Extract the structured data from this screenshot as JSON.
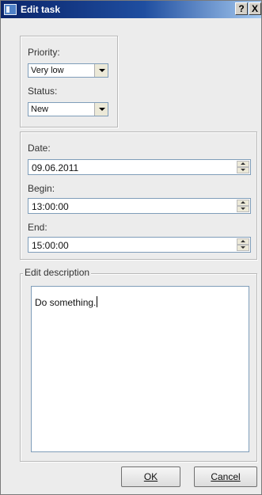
{
  "window": {
    "title": "Edit task",
    "help_label": "?",
    "close_label": "X"
  },
  "priority": {
    "label": "Priority:",
    "value": "Very low"
  },
  "status": {
    "label": "Status:",
    "value": "New"
  },
  "date": {
    "label": "Date:",
    "value": "09.06.2011"
  },
  "begin": {
    "label": "Begin:",
    "value": "13:00:00"
  },
  "end": {
    "label": "End:",
    "value": "15:00:00"
  },
  "description": {
    "legend": "Edit description",
    "text": "Do something."
  },
  "buttons": {
    "ok": "OK",
    "cancel": "Cancel"
  }
}
